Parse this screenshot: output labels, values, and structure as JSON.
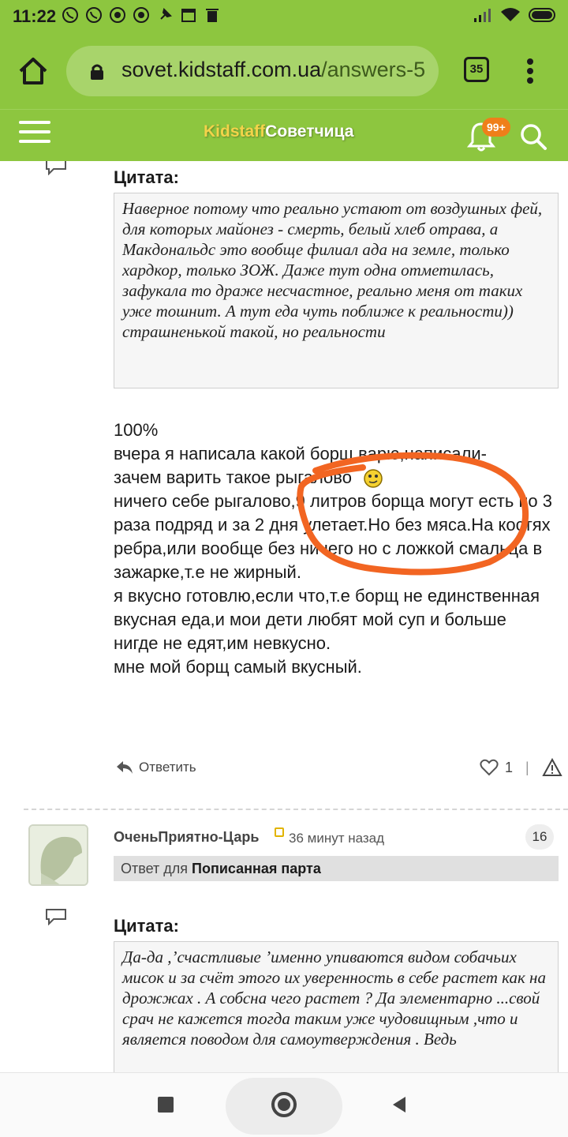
{
  "status_bar": {
    "time": "11:22",
    "notification_icons": [
      "viber-icon",
      "viber-icon",
      "chrome-icon",
      "chrome-icon",
      "pin-icon",
      "calendar-icon",
      "trash-icon"
    ],
    "right_icons": [
      "signal-icon",
      "wifi-icon",
      "battery-icon"
    ]
  },
  "browser": {
    "url_domain": "sovet.kidstaff.com.ua",
    "url_path": "/answers-5",
    "tab_count": "35"
  },
  "site_header": {
    "logo_part1": "Kidstaff",
    "logo_part2": "Советчица",
    "notification_badge": "99+"
  },
  "post1": {
    "quote_label": "Цитата:",
    "quote_text": "Наверное потому что реально устают от воздушных фей, для которых майонез - смерть, белый хлеб отрава, а Макдональдс это вообще филиал ада на земле, только хардкор, только ЗОЖ. Даже тут одна отметилась, зафукала то драже несчастное, реально меня от таких уже тошнит. А тут еда чуть поближе к реальности)) страшненькой такой, но реальности",
    "text_line1": "100%",
    "text_line2": "вчера я написала какой борщ варю,написали-",
    "text_line3": "зачем варить такое рыгалово",
    "text_rest": "ничего себе рыгалово,9 литров борща могут есть по 3 раза подряд и за 2 дня улетает.Но без мяса.На костях ребра,или вообще без ничего но с ложкой смальца в зажарке,т.е не жирный.",
    "text_line4": "я вкусно готовлю,если что,т.е борщ не единственная вкусная еда,и мои дети любят мой суп и больше нигде не едят,им невкусно.",
    "text_line5": "мне мой борщ самый вкусный.",
    "reply_label": "Ответить",
    "like_count": "1"
  },
  "post2": {
    "username": "ОченьПриятно-Царь",
    "time_ago": "36 минут назад",
    "post_number": "16",
    "reply_to_prefix": "Ответ для",
    "reply_to_name": "Пописанная парта",
    "quote_label": "Цитата:",
    "quote_text": "Да-да ,’счастливые ’именно упиваются видом собачьих мисок и за счёт этого их уверенность в себе растет как на дрожжах . А собсна чего растет ? Да элементарно ...свой срач не кажется тогда таким уже чудовищным ,что и является поводом для самоутверждения . Ведь"
  },
  "colors": {
    "brand_green": "#8dc63f",
    "logo_yellow": "#f3d34a",
    "badge_orange": "#ef7f1a",
    "annotation_orange": "#f26522"
  }
}
